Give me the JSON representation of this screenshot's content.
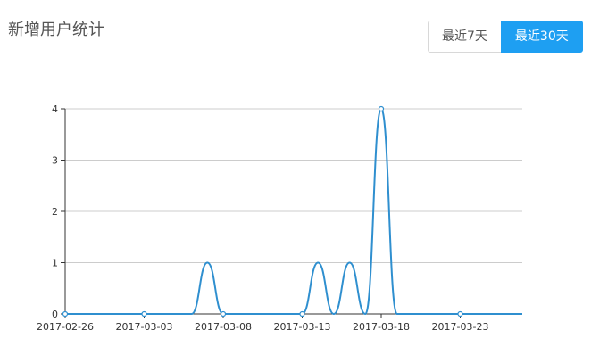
{
  "title": "新增用户统计",
  "range_buttons": [
    {
      "label": "最近7天",
      "active": false
    },
    {
      "label": "最近30天",
      "active": true
    }
  ],
  "colors": {
    "line": "#2f8fcf",
    "grid": "#cccccc",
    "axis": "#333333",
    "active_button": "#1e9ff2"
  },
  "chart_data": {
    "type": "line",
    "title": "",
    "xlabel": "",
    "ylabel": "",
    "x": [
      "2017-02-26",
      "2017-02-27",
      "2017-02-28",
      "2017-03-01",
      "2017-03-02",
      "2017-03-03",
      "2017-03-04",
      "2017-03-05",
      "2017-03-06",
      "2017-03-07",
      "2017-03-08",
      "2017-03-09",
      "2017-03-10",
      "2017-03-11",
      "2017-03-12",
      "2017-03-13",
      "2017-03-14",
      "2017-03-15",
      "2017-03-16",
      "2017-03-17",
      "2017-03-18",
      "2017-03-19",
      "2017-03-20",
      "2017-03-21",
      "2017-03-22",
      "2017-03-23",
      "2017-03-24",
      "2017-03-25",
      "2017-03-26"
    ],
    "series": [
      {
        "values": [
          0,
          0,
          0,
          0,
          0,
          0,
          0,
          0,
          0,
          1,
          0,
          0,
          0,
          0,
          0,
          0,
          1,
          0,
          1,
          0,
          4,
          0,
          0,
          0,
          0,
          0,
          0,
          0,
          0
        ]
      }
    ],
    "ylim": [
      0,
      4
    ],
    "yticks": [
      0,
      1,
      2,
      3,
      4
    ],
    "xtick_labels": [
      "2017-02-26",
      "2017-03-03",
      "2017-03-08",
      "2017-03-13",
      "2017-03-18",
      "2017-03-23"
    ],
    "symbol_x": [
      "2017-02-26",
      "2017-03-03",
      "2017-03-08",
      "2017-03-13",
      "2017-03-18",
      "2017-03-23"
    ],
    "grid": true,
    "smooth": true
  }
}
